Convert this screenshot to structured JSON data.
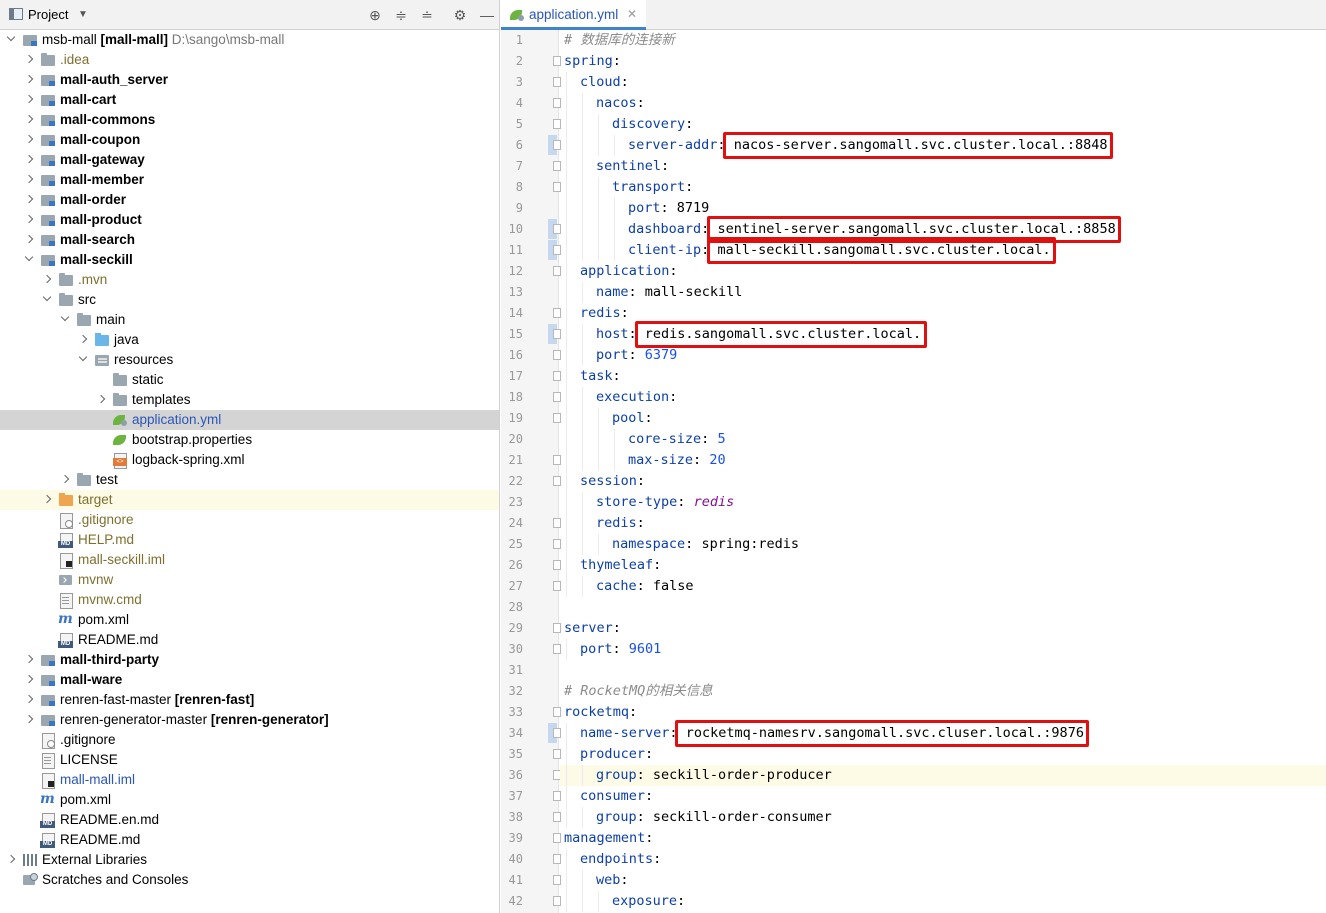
{
  "project_panel": {
    "title": "Project",
    "tree": [
      {
        "depth": 0,
        "arrow": "expanded",
        "icon": "module-folder-icon",
        "label": "msb-mall",
        "module": "[mall-mall]",
        "path": "D:\\sango\\msb-mall",
        "style": "normal"
      },
      {
        "depth": 1,
        "arrow": "collapsed",
        "icon": "folder-icon",
        "label": ".idea",
        "style": "olive"
      },
      {
        "depth": 1,
        "arrow": "collapsed",
        "icon": "module-folder-icon",
        "label": "mall-auth_server",
        "style": "bold"
      },
      {
        "depth": 1,
        "arrow": "collapsed",
        "icon": "module-folder-icon",
        "label": "mall-cart",
        "style": "bold"
      },
      {
        "depth": 1,
        "arrow": "collapsed",
        "icon": "module-folder-icon",
        "label": "mall-commons",
        "style": "bold"
      },
      {
        "depth": 1,
        "arrow": "collapsed",
        "icon": "module-folder-icon",
        "label": "mall-coupon",
        "style": "bold"
      },
      {
        "depth": 1,
        "arrow": "collapsed",
        "icon": "module-folder-icon",
        "label": "mall-gateway",
        "style": "bold"
      },
      {
        "depth": 1,
        "arrow": "collapsed",
        "icon": "module-folder-icon",
        "label": "mall-member",
        "style": "bold"
      },
      {
        "depth": 1,
        "arrow": "collapsed",
        "icon": "module-folder-icon",
        "label": "mall-order",
        "style": "bold"
      },
      {
        "depth": 1,
        "arrow": "collapsed",
        "icon": "module-folder-icon",
        "label": "mall-product",
        "style": "bold"
      },
      {
        "depth": 1,
        "arrow": "collapsed",
        "icon": "module-folder-icon",
        "label": "mall-search",
        "style": "bold"
      },
      {
        "depth": 1,
        "arrow": "expanded",
        "icon": "module-folder-icon",
        "label": "mall-seckill",
        "style": "bold"
      },
      {
        "depth": 2,
        "arrow": "collapsed",
        "icon": "folder-icon",
        "label": ".mvn",
        "style": "olive"
      },
      {
        "depth": 2,
        "arrow": "expanded",
        "icon": "folder-icon",
        "label": "src",
        "style": "normal"
      },
      {
        "depth": 3,
        "arrow": "expanded",
        "icon": "folder-icon",
        "label": "main",
        "style": "normal"
      },
      {
        "depth": 4,
        "arrow": "collapsed",
        "icon": "source-folder-icon",
        "label": "java",
        "style": "normal"
      },
      {
        "depth": 4,
        "arrow": "expanded",
        "icon": "resources-folder-icon",
        "label": "resources",
        "style": "normal"
      },
      {
        "depth": 5,
        "arrow": "none",
        "icon": "folder-icon",
        "label": "static",
        "style": "normal"
      },
      {
        "depth": 5,
        "arrow": "collapsed",
        "icon": "folder-icon",
        "label": "templates",
        "style": "normal"
      },
      {
        "depth": 5,
        "arrow": "none",
        "icon": "spring-yml-icon",
        "label": "application.yml",
        "style": "blue",
        "selected": true
      },
      {
        "depth": 5,
        "arrow": "none",
        "icon": "spring-properties-icon",
        "label": "bootstrap.properties",
        "style": "normal"
      },
      {
        "depth": 5,
        "arrow": "none",
        "icon": "xml-file-icon",
        "label": "logback-spring.xml",
        "style": "normal"
      },
      {
        "depth": 3,
        "arrow": "collapsed",
        "icon": "folder-icon",
        "label": "test",
        "style": "normal"
      },
      {
        "depth": 2,
        "arrow": "collapsed",
        "icon": "excluded-folder-icon",
        "label": "target",
        "style": "olive",
        "highlight": true
      },
      {
        "depth": 2,
        "arrow": "none",
        "icon": "gitignore-file-icon",
        "label": ".gitignore",
        "style": "olive"
      },
      {
        "depth": 2,
        "arrow": "none",
        "icon": "markdown-file-icon",
        "label": "HELP.md",
        "style": "olive"
      },
      {
        "depth": 2,
        "arrow": "none",
        "icon": "iml-file-icon",
        "label": "mall-seckill.iml",
        "style": "olive"
      },
      {
        "depth": 2,
        "arrow": "none",
        "icon": "script-file-icon",
        "label": "mvnw",
        "style": "olive"
      },
      {
        "depth": 2,
        "arrow": "none",
        "icon": "text-file-icon",
        "label": "mvnw.cmd",
        "style": "olive"
      },
      {
        "depth": 2,
        "arrow": "none",
        "icon": "maven-icon",
        "label": "pom.xml",
        "style": "normal"
      },
      {
        "depth": 2,
        "arrow": "none",
        "icon": "markdown-file-icon",
        "label": "README.md",
        "style": "normal"
      },
      {
        "depth": 1,
        "arrow": "collapsed",
        "icon": "module-folder-icon",
        "label": "mall-third-party",
        "style": "bold"
      },
      {
        "depth": 1,
        "arrow": "collapsed",
        "icon": "module-folder-icon",
        "label": "mall-ware",
        "style": "bold"
      },
      {
        "depth": 1,
        "arrow": "collapsed",
        "icon": "module-folder-icon",
        "label": "renren-fast-master",
        "module": "[renren-fast]",
        "style": "normal"
      },
      {
        "depth": 1,
        "arrow": "collapsed",
        "icon": "module-folder-icon",
        "label": "renren-generator-master",
        "module": "[renren-generator]",
        "style": "normal"
      },
      {
        "depth": 1,
        "arrow": "none",
        "icon": "gitignore-file-icon",
        "label": ".gitignore",
        "style": "normal"
      },
      {
        "depth": 1,
        "arrow": "none",
        "icon": "text-file-icon",
        "label": "LICENSE",
        "style": "normal"
      },
      {
        "depth": 1,
        "arrow": "none",
        "icon": "iml-file-icon",
        "label": "mall-mall.iml",
        "style": "blue"
      },
      {
        "depth": 1,
        "arrow": "none",
        "icon": "maven-icon",
        "label": "pom.xml",
        "style": "normal"
      },
      {
        "depth": 1,
        "arrow": "none",
        "icon": "markdown-file-icon",
        "label": "README.en.md",
        "style": "normal"
      },
      {
        "depth": 1,
        "arrow": "none",
        "icon": "markdown-file-icon",
        "label": "README.md",
        "style": "normal"
      },
      {
        "depth": 0,
        "arrow": "collapsed",
        "icon": "libraries-icon",
        "label": "External Libraries",
        "style": "normal"
      },
      {
        "depth": 0,
        "arrow": "none",
        "icon": "scratches-icon",
        "label": "Scratches and Consoles",
        "style": "normal"
      }
    ]
  },
  "editor": {
    "tab_label": "application.yml",
    "maven_glyph": "m",
    "current_line": 36,
    "lines": [
      {
        "n": 1,
        "indent": 0,
        "comment": "# 数据库的连接新"
      },
      {
        "n": 2,
        "indent": 0,
        "key": "spring"
      },
      {
        "n": 3,
        "indent": 1,
        "key": "cloud"
      },
      {
        "n": 4,
        "indent": 2,
        "key": "nacos"
      },
      {
        "n": 5,
        "indent": 3,
        "key": "discovery"
      },
      {
        "n": 6,
        "indent": 4,
        "key": "server-addr",
        "value": "nacos-server.sangomall.svc.cluster.local.:8848",
        "vtype": "str",
        "boxed": true
      },
      {
        "n": 7,
        "indent": 2,
        "key": "sentinel"
      },
      {
        "n": 8,
        "indent": 3,
        "key": "transport"
      },
      {
        "n": 9,
        "indent": 4,
        "key": "port",
        "value": "8719",
        "vtype": "str"
      },
      {
        "n": 10,
        "indent": 4,
        "key": "dashboard",
        "value": "sentinel-server.sangomall.svc.cluster.local.:8858",
        "vtype": "str",
        "boxed": true
      },
      {
        "n": 11,
        "indent": 4,
        "key": "client-ip",
        "value": "mall-seckill.sangomall.svc.cluster.local.",
        "vtype": "str",
        "boxed": true
      },
      {
        "n": 12,
        "indent": 1,
        "key": "application"
      },
      {
        "n": 13,
        "indent": 2,
        "key": "name",
        "value": "mall-seckill",
        "vtype": "str"
      },
      {
        "n": 14,
        "indent": 1,
        "key": "redis"
      },
      {
        "n": 15,
        "indent": 2,
        "key": "host",
        "value": "redis.sangomall.svc.cluster.local.",
        "vtype": "str",
        "boxed": true
      },
      {
        "n": 16,
        "indent": 2,
        "key": "port",
        "value": "6379",
        "vtype": "num"
      },
      {
        "n": 17,
        "indent": 1,
        "key": "task"
      },
      {
        "n": 18,
        "indent": 2,
        "key": "execution"
      },
      {
        "n": 19,
        "indent": 3,
        "key": "pool"
      },
      {
        "n": 20,
        "indent": 4,
        "key": "core-size",
        "value": "5",
        "vtype": "num"
      },
      {
        "n": 21,
        "indent": 4,
        "key": "max-size",
        "value": "20",
        "vtype": "num"
      },
      {
        "n": 22,
        "indent": 1,
        "key": "session"
      },
      {
        "n": 23,
        "indent": 2,
        "key": "store-type",
        "value": "redis",
        "vtype": "ital"
      },
      {
        "n": 24,
        "indent": 2,
        "key": "redis"
      },
      {
        "n": 25,
        "indent": 3,
        "key": "namespace",
        "value": "spring:redis",
        "vtype": "str"
      },
      {
        "n": 26,
        "indent": 1,
        "key": "thymeleaf"
      },
      {
        "n": 27,
        "indent": 2,
        "key": "cache",
        "value": "false",
        "vtype": "str"
      },
      {
        "n": 28,
        "indent": 0
      },
      {
        "n": 29,
        "indent": 0,
        "key": "server"
      },
      {
        "n": 30,
        "indent": 1,
        "key": "port",
        "value": "9601",
        "vtype": "num"
      },
      {
        "n": 31,
        "indent": 0
      },
      {
        "n": 32,
        "indent": 0,
        "comment": "# RocketMQ的相关信息"
      },
      {
        "n": 33,
        "indent": 0,
        "key": "rocketmq"
      },
      {
        "n": 34,
        "indent": 1,
        "key": "name-server",
        "value": "rocketmq-namesrv.sangomall.svc.cluser.local.:9876",
        "vtype": "str",
        "boxed": true
      },
      {
        "n": 35,
        "indent": 1,
        "key": "producer"
      },
      {
        "n": 36,
        "indent": 2,
        "key": "group",
        "value": "seckill-order-producer",
        "vtype": "str"
      },
      {
        "n": 37,
        "indent": 1,
        "key": "consumer"
      },
      {
        "n": 38,
        "indent": 2,
        "key": "group",
        "value": "seckill-order-consumer",
        "vtype": "str"
      },
      {
        "n": 39,
        "indent": 0,
        "key": "management"
      },
      {
        "n": 40,
        "indent": 1,
        "key": "endpoints"
      },
      {
        "n": 41,
        "indent": 2,
        "key": "web"
      },
      {
        "n": 42,
        "indent": 3,
        "key": "exposure"
      }
    ]
  },
  "colors": {
    "yaml_key": "#0c3fa8",
    "number": "#1750eb",
    "comment": "#8c8c8c",
    "annotation_box": "#e01010",
    "selection": "#d4d4d4",
    "current_line": "#fdfbe6"
  }
}
